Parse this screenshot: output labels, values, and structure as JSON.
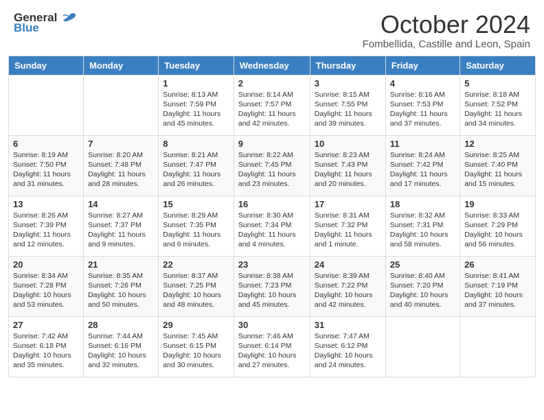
{
  "header": {
    "logo_general": "General",
    "logo_blue": "Blue",
    "month_title": "October 2024",
    "location": "Fombellida, Castille and Leon, Spain"
  },
  "days_of_week": [
    "Sunday",
    "Monday",
    "Tuesday",
    "Wednesday",
    "Thursday",
    "Friday",
    "Saturday"
  ],
  "weeks": [
    [
      {
        "day": "",
        "info": ""
      },
      {
        "day": "",
        "info": ""
      },
      {
        "day": "1",
        "info": "Sunrise: 8:13 AM\nSunset: 7:59 PM\nDaylight: 11 hours and 45 minutes."
      },
      {
        "day": "2",
        "info": "Sunrise: 8:14 AM\nSunset: 7:57 PM\nDaylight: 11 hours and 42 minutes."
      },
      {
        "day": "3",
        "info": "Sunrise: 8:15 AM\nSunset: 7:55 PM\nDaylight: 11 hours and 39 minutes."
      },
      {
        "day": "4",
        "info": "Sunrise: 8:16 AM\nSunset: 7:53 PM\nDaylight: 11 hours and 37 minutes."
      },
      {
        "day": "5",
        "info": "Sunrise: 8:18 AM\nSunset: 7:52 PM\nDaylight: 11 hours and 34 minutes."
      }
    ],
    [
      {
        "day": "6",
        "info": "Sunrise: 8:19 AM\nSunset: 7:50 PM\nDaylight: 11 hours and 31 minutes."
      },
      {
        "day": "7",
        "info": "Sunrise: 8:20 AM\nSunset: 7:48 PM\nDaylight: 11 hours and 28 minutes."
      },
      {
        "day": "8",
        "info": "Sunrise: 8:21 AM\nSunset: 7:47 PM\nDaylight: 11 hours and 26 minutes."
      },
      {
        "day": "9",
        "info": "Sunrise: 8:22 AM\nSunset: 7:45 PM\nDaylight: 11 hours and 23 minutes."
      },
      {
        "day": "10",
        "info": "Sunrise: 8:23 AM\nSunset: 7:43 PM\nDaylight: 11 hours and 20 minutes."
      },
      {
        "day": "11",
        "info": "Sunrise: 8:24 AM\nSunset: 7:42 PM\nDaylight: 11 hours and 17 minutes."
      },
      {
        "day": "12",
        "info": "Sunrise: 8:25 AM\nSunset: 7:40 PM\nDaylight: 11 hours and 15 minutes."
      }
    ],
    [
      {
        "day": "13",
        "info": "Sunrise: 8:26 AM\nSunset: 7:39 PM\nDaylight: 11 hours and 12 minutes."
      },
      {
        "day": "14",
        "info": "Sunrise: 8:27 AM\nSunset: 7:37 PM\nDaylight: 11 hours and 9 minutes."
      },
      {
        "day": "15",
        "info": "Sunrise: 8:29 AM\nSunset: 7:35 PM\nDaylight: 11 hours and 6 minutes."
      },
      {
        "day": "16",
        "info": "Sunrise: 8:30 AM\nSunset: 7:34 PM\nDaylight: 11 hours and 4 minutes."
      },
      {
        "day": "17",
        "info": "Sunrise: 8:31 AM\nSunset: 7:32 PM\nDaylight: 11 hours and 1 minute."
      },
      {
        "day": "18",
        "info": "Sunrise: 8:32 AM\nSunset: 7:31 PM\nDaylight: 10 hours and 58 minutes."
      },
      {
        "day": "19",
        "info": "Sunrise: 8:33 AM\nSunset: 7:29 PM\nDaylight: 10 hours and 56 minutes."
      }
    ],
    [
      {
        "day": "20",
        "info": "Sunrise: 8:34 AM\nSunset: 7:28 PM\nDaylight: 10 hours and 53 minutes."
      },
      {
        "day": "21",
        "info": "Sunrise: 8:35 AM\nSunset: 7:26 PM\nDaylight: 10 hours and 50 minutes."
      },
      {
        "day": "22",
        "info": "Sunrise: 8:37 AM\nSunset: 7:25 PM\nDaylight: 10 hours and 48 minutes."
      },
      {
        "day": "23",
        "info": "Sunrise: 8:38 AM\nSunset: 7:23 PM\nDaylight: 10 hours and 45 minutes."
      },
      {
        "day": "24",
        "info": "Sunrise: 8:39 AM\nSunset: 7:22 PM\nDaylight: 10 hours and 42 minutes."
      },
      {
        "day": "25",
        "info": "Sunrise: 8:40 AM\nSunset: 7:20 PM\nDaylight: 10 hours and 40 minutes."
      },
      {
        "day": "26",
        "info": "Sunrise: 8:41 AM\nSunset: 7:19 PM\nDaylight: 10 hours and 37 minutes."
      }
    ],
    [
      {
        "day": "27",
        "info": "Sunrise: 7:42 AM\nSunset: 6:18 PM\nDaylight: 10 hours and 35 minutes."
      },
      {
        "day": "28",
        "info": "Sunrise: 7:44 AM\nSunset: 6:16 PM\nDaylight: 10 hours and 32 minutes."
      },
      {
        "day": "29",
        "info": "Sunrise: 7:45 AM\nSunset: 6:15 PM\nDaylight: 10 hours and 30 minutes."
      },
      {
        "day": "30",
        "info": "Sunrise: 7:46 AM\nSunset: 6:14 PM\nDaylight: 10 hours and 27 minutes."
      },
      {
        "day": "31",
        "info": "Sunrise: 7:47 AM\nSunset: 6:12 PM\nDaylight: 10 hours and 24 minutes."
      },
      {
        "day": "",
        "info": ""
      },
      {
        "day": "",
        "info": ""
      }
    ]
  ]
}
